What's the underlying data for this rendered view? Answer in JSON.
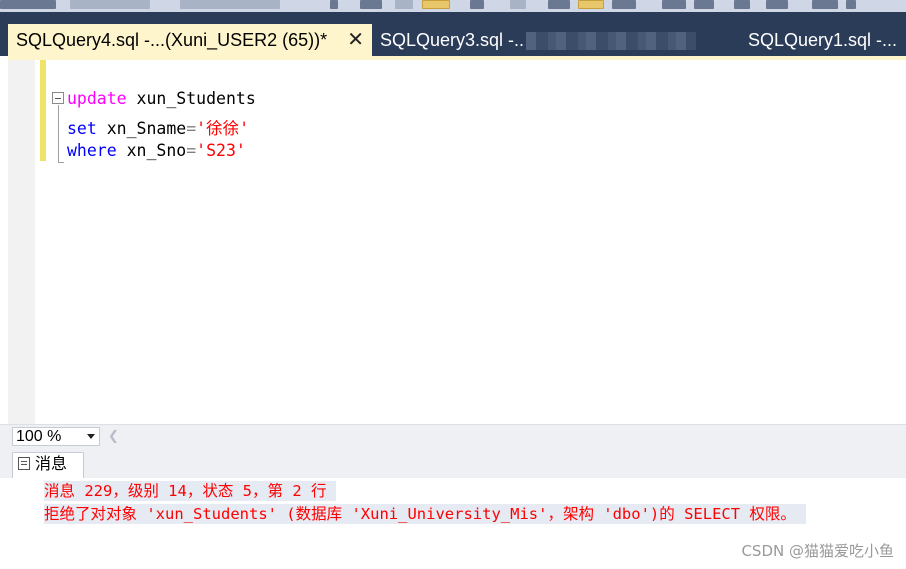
{
  "tabs": [
    {
      "label": "SQLQuery4.sql -...(Xuni_USER2 (65))*",
      "active": true
    },
    {
      "label": "SQLQuery3.sql -..",
      "active": false
    },
    {
      "label": "SQLQuery1.sql -...",
      "active": false
    }
  ],
  "editor": {
    "lines": [
      {
        "keyword": "update",
        "rest": " xun_Students"
      },
      {
        "keyword": "set",
        "rest": " xn_Sname",
        "op": "=",
        "string": "'徐徐'"
      },
      {
        "keyword": "where",
        "rest": " xn_Sno",
        "op": "=",
        "string": "'S23'"
      }
    ]
  },
  "zoom": {
    "value": "100 %"
  },
  "results": {
    "tab_label": "消息",
    "messages": [
      "消息 229，级别 14，状态 5，第 2 行",
      "拒绝了对对象 'xun_Students' (数据库 'Xuni_University_Mis'，架构 'dbo')的 SELECT 权限。"
    ]
  },
  "watermark": "CSDN @猫猫爱吃小鱼",
  "colors": {
    "tab_strip": "#2b3c59",
    "active_tab": "#fff5cc",
    "keyword_pink": "#ff00ff",
    "keyword_blue": "#0000ff",
    "string_red": "#ff0000",
    "error_text": "#ff0000"
  }
}
